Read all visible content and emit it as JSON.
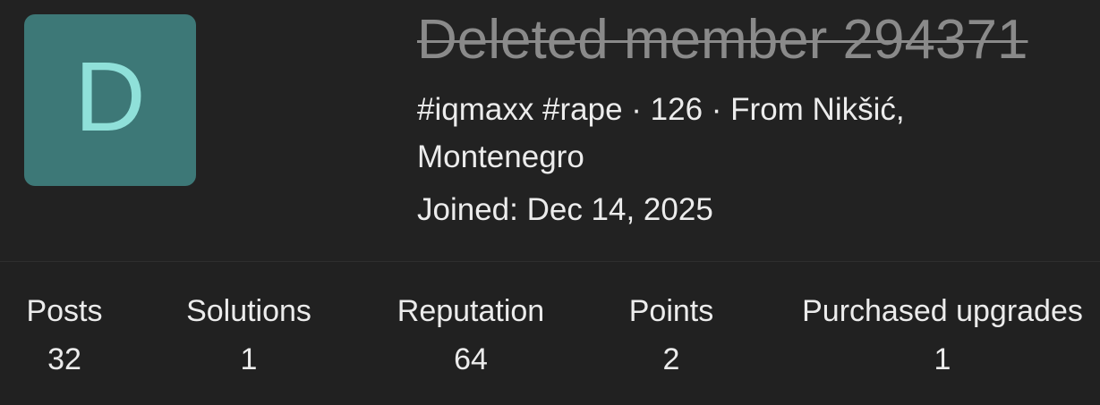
{
  "profile": {
    "avatar_letter": "D",
    "avatar_color": "#3d7877",
    "avatar_letter_color": "#8fe0d9",
    "username": "Deleted member 294371",
    "info": "#iqmaxx #rape · 126 · From Nikšić, Montenegro",
    "joined": "Joined: Dec 14, 2025"
  },
  "stats": [
    {
      "label": "Posts",
      "value": "32"
    },
    {
      "label": "Solutions",
      "value": "1"
    },
    {
      "label": "Reputation",
      "value": "64"
    },
    {
      "label": "Points",
      "value": "2"
    },
    {
      "label": "Purchased upgrades",
      "value": "1"
    }
  ]
}
